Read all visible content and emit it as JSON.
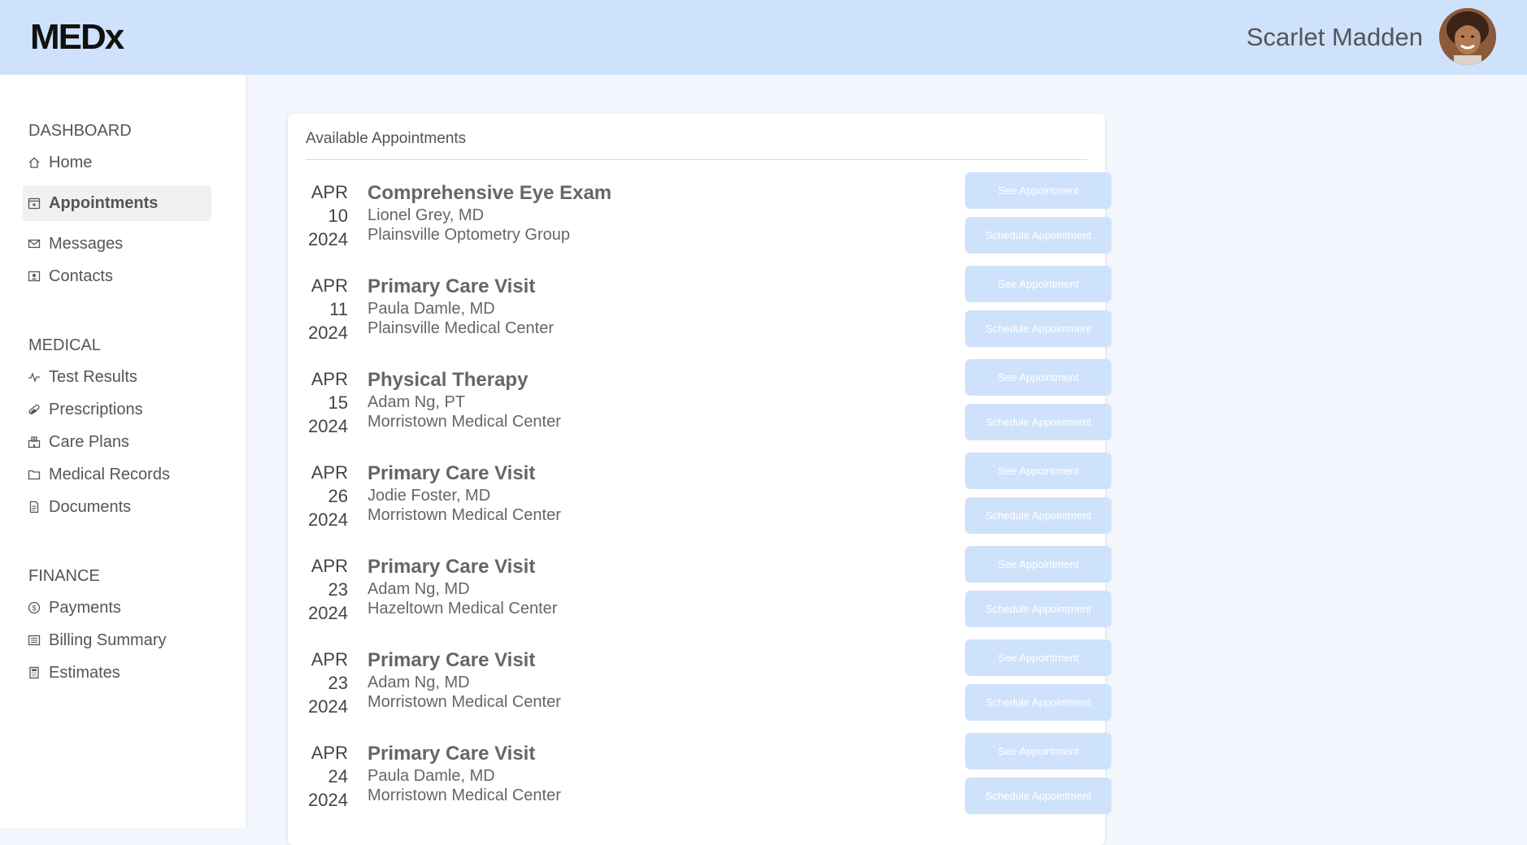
{
  "header": {
    "logo": "MEDx",
    "user_name": "Scarlet Madden"
  },
  "sidebar": {
    "sections": [
      {
        "title": "DASHBOARD",
        "items": [
          {
            "label": "Home",
            "icon": "home-icon"
          },
          {
            "label": "Appointments",
            "icon": "calendar-icon",
            "active": true
          },
          {
            "label": "Messages",
            "icon": "envelope-icon"
          },
          {
            "label": "Contacts",
            "icon": "contact-card-icon"
          }
        ]
      },
      {
        "title": "MEDICAL",
        "items": [
          {
            "label": "Test Results",
            "icon": "pulse-icon"
          },
          {
            "label": "Prescriptions",
            "icon": "pill-icon"
          },
          {
            "label": "Care Plans",
            "icon": "hospital-icon"
          },
          {
            "label": "Medical Records",
            "icon": "folder-icon"
          },
          {
            "label": "Documents",
            "icon": "document-icon"
          }
        ]
      },
      {
        "title": "FINANCE",
        "items": [
          {
            "label": "Payments",
            "icon": "dollar-coin-icon"
          },
          {
            "label": "Billing Summary",
            "icon": "receipt-icon"
          },
          {
            "label": "Estimates",
            "icon": "calculator-icon"
          }
        ]
      }
    ]
  },
  "main": {
    "card_title": "Available Appointments",
    "see_label": "See Appointment",
    "schedule_label": "Schedule Appointment",
    "appointments": [
      {
        "month": "APR",
        "day": "10",
        "year": "2024",
        "title": "Comprehensive Eye Exam",
        "provider": "Lionel Grey, MD",
        "location": "Plainsville Optometry Group"
      },
      {
        "month": "APR",
        "day": "11",
        "year": "2024",
        "title": "Primary Care Visit",
        "provider": "Paula Damle, MD",
        "location": "Plainsville Medical Center"
      },
      {
        "month": "APR",
        "day": "15",
        "year": "2024",
        "title": "Physical Therapy",
        "provider": "Adam Ng, PT",
        "location": "Morristown Medical Center"
      },
      {
        "month": "APR",
        "day": "26",
        "year": "2024",
        "title": "Primary Care Visit",
        "provider": "Jodie Foster, MD",
        "location": "Morristown Medical Center"
      },
      {
        "month": "APR",
        "day": "23",
        "year": "2024",
        "title": "Primary Care Visit",
        "provider": "Adam Ng, MD",
        "location": "Hazeltown Medical Center"
      },
      {
        "month": "APR",
        "day": "23",
        "year": "2024",
        "title": "Primary Care Visit",
        "provider": "Adam Ng, MD",
        "location": "Morristown Medical Center"
      },
      {
        "month": "APR",
        "day": "24",
        "year": "2024",
        "title": "Primary Care Visit",
        "provider": "Paula Damle, MD",
        "location": "Morristown Medical Center"
      }
    ]
  },
  "colors": {
    "header_bg": "#cfe2fc",
    "button_bg": "#cfe2fc",
    "page_bg": "#f3f7fd"
  }
}
